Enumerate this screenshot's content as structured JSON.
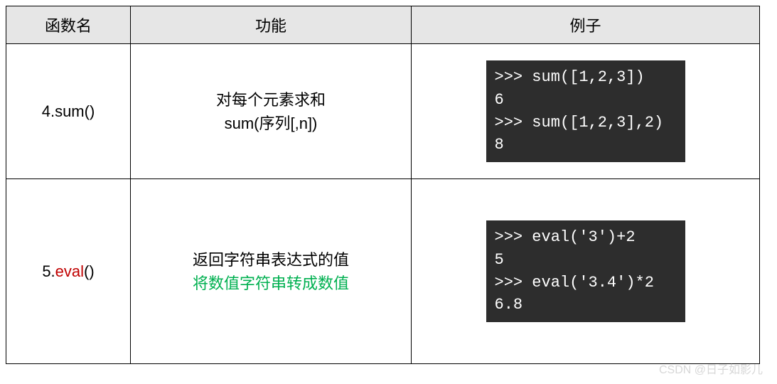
{
  "headers": {
    "name": "函数名",
    "func": "功能",
    "example": "例子"
  },
  "rows": [
    {
      "fn_number": "4.",
      "fn_name": "sum",
      "fn_paren": "()",
      "fn_highlight": false,
      "desc_lines": [
        {
          "text": "对每个元素求和",
          "green": false
        },
        {
          "text": "sum(序列[,n])",
          "green": false
        }
      ],
      "code_lines": [
        ">>> sum([1,2,3])",
        "6",
        ">>> sum([1,2,3],2)",
        "8"
      ]
    },
    {
      "fn_number": "5.",
      "fn_name": "eval",
      "fn_paren": "()",
      "fn_highlight": true,
      "desc_lines": [
        {
          "text": "返回字符串表达式的值",
          "green": false
        },
        {
          "text": "将数值字符串转成数值",
          "green": true
        }
      ],
      "code_lines": [
        ">>> eval('3')+2",
        "5",
        ">>> eval('3.4')*2",
        "6.8"
      ]
    }
  ],
  "watermark": "CSDN @日子如影儿"
}
